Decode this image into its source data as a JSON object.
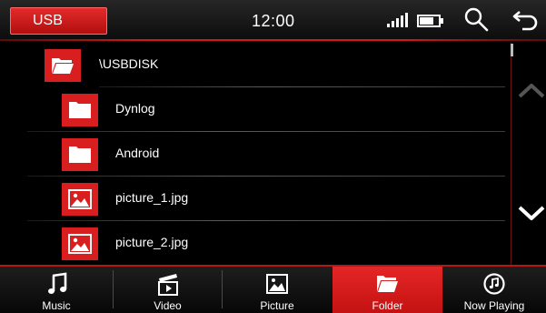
{
  "header": {
    "source_label": "USB",
    "time": "12:00",
    "icons": [
      "signal-icon",
      "battery-icon",
      "search-icon",
      "back-icon"
    ]
  },
  "file_list": {
    "root": {
      "name": "\\USBDISK",
      "type": "folder-open"
    },
    "items": [
      {
        "name": "Dynlog",
        "type": "folder"
      },
      {
        "name": "Android",
        "type": "folder"
      },
      {
        "name": "picture_1.jpg",
        "type": "picture"
      },
      {
        "name": "picture_2.jpg",
        "type": "picture"
      }
    ]
  },
  "nav": {
    "tabs": [
      {
        "label": "Music",
        "icon": "music-note-icon"
      },
      {
        "label": "Video",
        "icon": "video-clapper-icon"
      },
      {
        "label": "Picture",
        "icon": "picture-icon"
      },
      {
        "label": "Folder",
        "icon": "folder-icon",
        "active": true
      },
      {
        "label": "Now Playing",
        "icon": "now-playing-icon"
      }
    ]
  },
  "colors": {
    "accent": "#d81e1e",
    "background": "#000000",
    "text": "#ffffff"
  }
}
